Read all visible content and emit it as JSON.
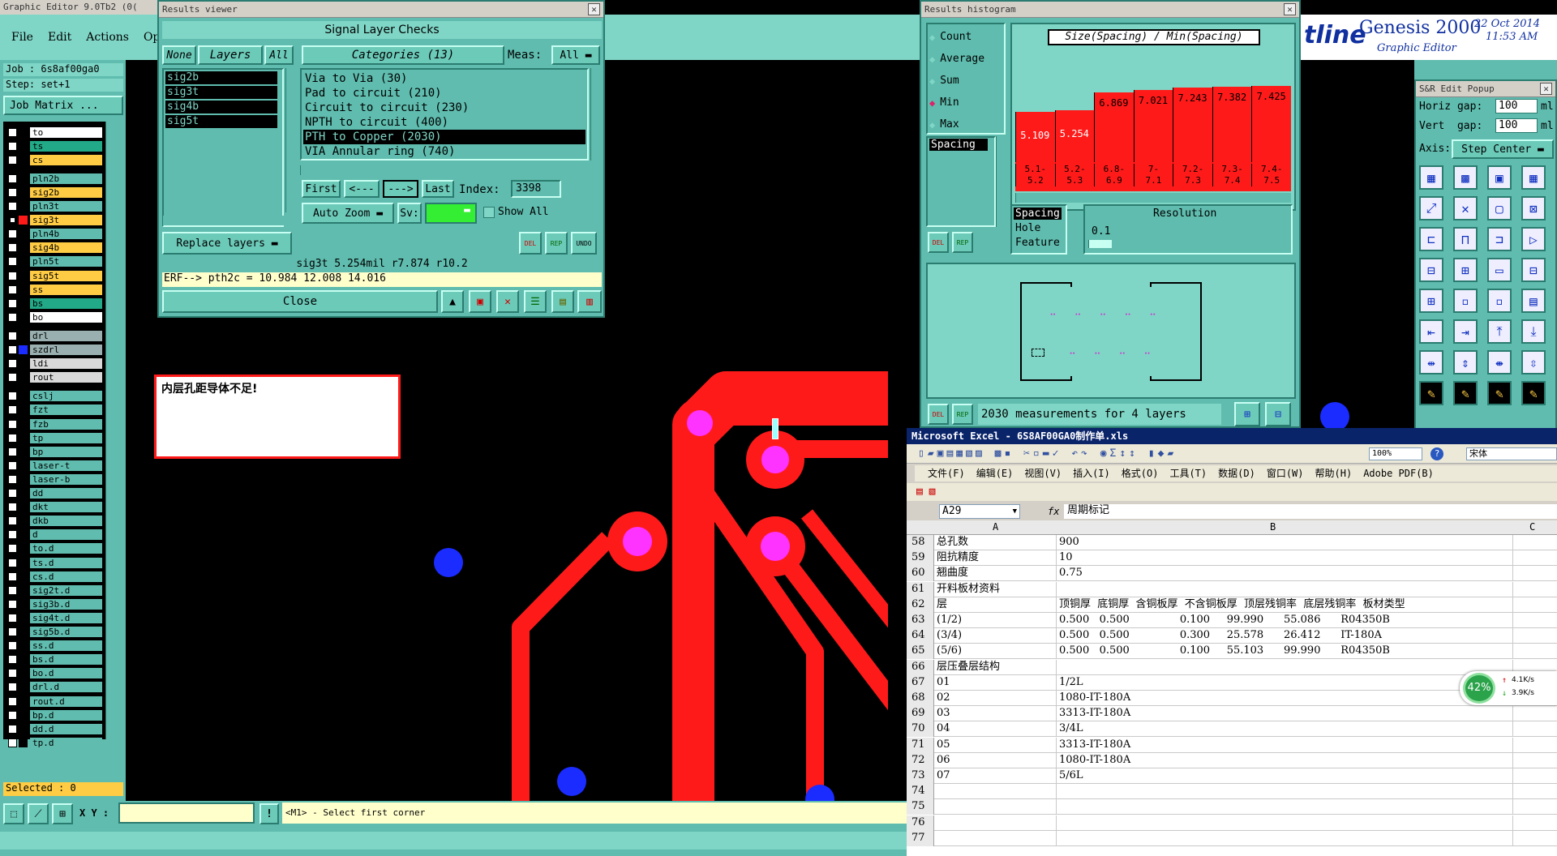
{
  "editor": {
    "title": "Graphic Editor 9.0Tb2 (0(",
    "menu": [
      "File",
      "Edit",
      "Actions",
      "Optic"
    ],
    "job": "Job : 6s8af00ga0",
    "step": "Step: set+1",
    "job_matrix": "Job Matrix ...",
    "selected": "Selected : 0",
    "xy_label": "X Y :",
    "xy_value": "",
    "status_msg": "<M1> - Select first corner"
  },
  "layers": [
    {
      "name": "to",
      "color": "#ffffff",
      "check": "on",
      "ccol": ""
    },
    {
      "name": "ts",
      "color": "#22aa88",
      "check": "on",
      "ccol": ""
    },
    {
      "name": "cs",
      "color": "#ffcc44",
      "check": "on",
      "ccol": ""
    },
    {
      "name": "pln2b",
      "color": "#5fbcae",
      "check": "on",
      "ccol": ""
    },
    {
      "name": "sig2b",
      "color": "#ffcc44",
      "check": "on",
      "ccol": ""
    },
    {
      "name": "pln3t",
      "color": "#5fbcae",
      "check": "on",
      "ccol": ""
    },
    {
      "name": "sig3t",
      "color": "#ffcc44",
      "check": "dark",
      "ccol": "#ff1a1a"
    },
    {
      "name": "pln4b",
      "color": "#5fbcae",
      "check": "on",
      "ccol": ""
    },
    {
      "name": "sig4b",
      "color": "#ffcc44",
      "check": "on",
      "ccol": ""
    },
    {
      "name": "pln5t",
      "color": "#5fbcae",
      "check": "on",
      "ccol": ""
    },
    {
      "name": "sig5t",
      "color": "#ffcc44",
      "check": "on",
      "ccol": ""
    },
    {
      "name": "ss",
      "color": "#ffcc44",
      "check": "on",
      "ccol": ""
    },
    {
      "name": "bs",
      "color": "#22aa88",
      "check": "on",
      "ccol": ""
    },
    {
      "name": "bo",
      "color": "#ffffff",
      "check": "on",
      "ccol": ""
    },
    {
      "name": "drl",
      "color": "#9ab0b0",
      "check": "on",
      "ccol": ""
    },
    {
      "name": "szdrl",
      "color": "#9ab0b0",
      "check": "on",
      "ccol": "#1a2cff"
    },
    {
      "name": "ldi",
      "color": "#d9d9d9",
      "check": "on",
      "ccol": ""
    },
    {
      "name": "rout",
      "color": "#d9d9d9",
      "check": "on",
      "ccol": ""
    },
    {
      "name": "cslj",
      "color": "#5fbcae",
      "check": "on",
      "ccol": ""
    },
    {
      "name": "fzt",
      "color": "#5fbcae",
      "check": "on",
      "ccol": ""
    },
    {
      "name": "fzb",
      "color": "#5fbcae",
      "check": "on",
      "ccol": ""
    },
    {
      "name": "tp",
      "color": "#5fbcae",
      "check": "on",
      "ccol": ""
    },
    {
      "name": "bp",
      "color": "#5fbcae",
      "check": "on",
      "ccol": ""
    },
    {
      "name": "laser-t",
      "color": "#5fbcae",
      "check": "on",
      "ccol": ""
    },
    {
      "name": "laser-b",
      "color": "#5fbcae",
      "check": "on",
      "ccol": ""
    },
    {
      "name": "dd",
      "color": "#5fbcae",
      "check": "on",
      "ccol": ""
    },
    {
      "name": "dkt",
      "color": "#5fbcae",
      "check": "on",
      "ccol": ""
    },
    {
      "name": "dkb",
      "color": "#5fbcae",
      "check": "on",
      "ccol": ""
    },
    {
      "name": "d",
      "color": "#5fbcae",
      "check": "on",
      "ccol": ""
    },
    {
      "name": "to.d",
      "color": "#5fbcae",
      "check": "on",
      "ccol": ""
    },
    {
      "name": "ts.d",
      "color": "#5fbcae",
      "check": "on",
      "ccol": ""
    },
    {
      "name": "cs.d",
      "color": "#5fbcae",
      "check": "on",
      "ccol": ""
    },
    {
      "name": "sig2t.d",
      "color": "#5fbcae",
      "check": "on",
      "ccol": ""
    },
    {
      "name": "sig3b.d",
      "color": "#5fbcae",
      "check": "on",
      "ccol": ""
    },
    {
      "name": "sig4t.d",
      "color": "#5fbcae",
      "check": "on",
      "ccol": ""
    },
    {
      "name": "sig5b.d",
      "color": "#5fbcae",
      "check": "on",
      "ccol": ""
    },
    {
      "name": "ss.d",
      "color": "#5fbcae",
      "check": "on",
      "ccol": ""
    },
    {
      "name": "bs.d",
      "color": "#5fbcae",
      "check": "on",
      "ccol": ""
    },
    {
      "name": "bo.d",
      "color": "#5fbcae",
      "check": "on",
      "ccol": ""
    },
    {
      "name": "drl.d",
      "color": "#5fbcae",
      "check": "on",
      "ccol": ""
    },
    {
      "name": "rout.d",
      "color": "#5fbcae",
      "check": "on",
      "ccol": ""
    },
    {
      "name": "bp.d",
      "color": "#5fbcae",
      "check": "on",
      "ccol": ""
    },
    {
      "name": "dd.d",
      "color": "#5fbcae",
      "check": "on",
      "ccol": ""
    },
    {
      "name": "tp.d",
      "color": "#5fbcae",
      "check": "on",
      "ccol": ""
    }
  ],
  "note": {
    "text": "内层孔距导体不足!"
  },
  "results": {
    "title": "Results viewer",
    "header": "Signal Layer Checks",
    "none": "None",
    "layers_tab": "Layers",
    "all": "All",
    "categories": "Categories (13)",
    "meas_label": "Meas:",
    "meas_value": "All",
    "layer_list": [
      "sig2b",
      "sig3t",
      "sig4b",
      "sig5t"
    ],
    "cat_list": [
      "Via to Via (30)",
      "Pad to circuit (210)",
      "Circuit to circuit (230)",
      "NPTH to circuit (400)",
      "PTH to Copper (2030)",
      "VIA Annular ring (740)"
    ],
    "cat_selected": 4,
    "first": "First",
    "prev": "<---",
    "next": "--->",
    "last": "Last",
    "index_label": "Index:",
    "index_value": "3398",
    "auto_zoom": "Auto Zoom",
    "sv_label": "Sv:",
    "show_all": "Show All",
    "replace_layers": "Replace layers",
    "del": "DEL",
    "rep": "REP",
    "undo": "UNDO",
    "status1": "sig3t 5.254mil  r7.874  r10.2",
    "status2": "ERF--> pth2c = 10.984 12.008 14.016",
    "close": "Close"
  },
  "histogram": {
    "title": "Results histogram",
    "opts": [
      "Count",
      "Average",
      "Sum",
      "Min",
      "Max"
    ],
    "opt_selected": 3,
    "header": "Size(Spacing) / Min(Spacing)",
    "list_item": "Spacing",
    "values": [
      5.109,
      5.254,
      6.869,
      7.021,
      7.243,
      7.382,
      7.425
    ],
    "value_labels": [
      "5.109",
      "5.254",
      "6.869",
      "7.021",
      "7.243",
      "7.382",
      "7.425"
    ],
    "ranges": [
      "5.1-\n5.2",
      "5.2-\n5.3",
      "6.8-\n6.9",
      "7-\n7.1",
      "7.2-\n7.3",
      "7.3-\n7.4",
      "7.4-\n7.5"
    ],
    "types": [
      "Spacing",
      "Hole",
      "Feature"
    ],
    "resolution_label": "Resolution",
    "resolution_value": "0.1",
    "summary": "2030 measurements for 4 layers",
    "del": "DEL",
    "rep": "REP"
  },
  "genesis": {
    "brand": "tline",
    "name": "Genesis 2000",
    "sub": "Graphic Editor",
    "date": "22 Oct 2014",
    "time": "11:53 AM"
  },
  "sr": {
    "title": "S&R Edit Popup",
    "hgap_label": "Horiz gap:",
    "hgap": "100",
    "hunit": "ml",
    "vgap_label": "Vert  gap:",
    "vgap": "100",
    "vunit": "ml",
    "axis_label": "Axis:",
    "axis_value": "Step Center"
  },
  "excel": {
    "title": "Microsoft Excel - 6S8AF00GA0制作单.xls",
    "menu": [
      "文件(F)",
      "编辑(E)",
      "视图(V)",
      "插入(I)",
      "格式(O)",
      "工具(T)",
      "数据(D)",
      "窗口(W)",
      "帮助(H)",
      "Adobe PDF(B)"
    ],
    "zoom": "100%",
    "font": "宋体",
    "cellref": "A29",
    "fx": "fx",
    "formula": "周期标记",
    "colA": "A",
    "colB": "B",
    "colC": "C",
    "rows": [
      {
        "n": "58",
        "a": "总孔数",
        "b": "900"
      },
      {
        "n": "59",
        "a": "阻抗精度",
        "b": "10"
      },
      {
        "n": "60",
        "a": "翘曲度",
        "b": "0.75"
      },
      {
        "n": "61",
        "a": "开料板材资料",
        "b": ""
      },
      {
        "n": "62",
        "a": "层",
        "b": "顶铜厚  底铜厚  含铜板厚  不含铜板厚  顶层残铜率  底层残铜率  板材类型"
      },
      {
        "n": "63",
        "a": "(1/2)",
        "b": "0.500   0.500               0.100     99.990      55.086      R04350B"
      },
      {
        "n": "64",
        "a": "(3/4)",
        "b": "0.500   0.500               0.300     25.578      26.412      IT-180A"
      },
      {
        "n": "65",
        "a": "(5/6)",
        "b": "0.500   0.500               0.100     55.103      99.990      R04350B"
      },
      {
        "n": "66",
        "a": "层压叠层结构",
        "b": ""
      },
      {
        "n": "67",
        "a": "01",
        "b": "1/2L"
      },
      {
        "n": "68",
        "a": "02",
        "b": "1080-IT-180A"
      },
      {
        "n": "69",
        "a": "03",
        "b": "3313-IT-180A"
      },
      {
        "n": "70",
        "a": "04",
        "b": "3/4L"
      },
      {
        "n": "71",
        "a": "05",
        "b": "3313-IT-180A"
      },
      {
        "n": "72",
        "a": "06",
        "b": "1080-IT-180A"
      },
      {
        "n": "73",
        "a": "07",
        "b": "5/6L"
      },
      {
        "n": "74",
        "a": "",
        "b": ""
      },
      {
        "n": "75",
        "a": "",
        "b": ""
      },
      {
        "n": "76",
        "a": "",
        "b": ""
      },
      {
        "n": "77",
        "a": "",
        "b": ""
      }
    ],
    "net": {
      "pct": "42%",
      "up": "4.1K/s",
      "down": "3.9K/s"
    }
  }
}
